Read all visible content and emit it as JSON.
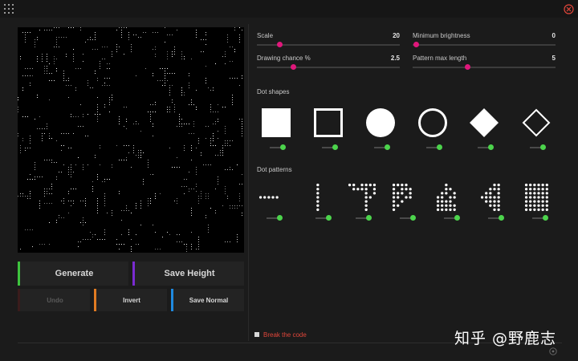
{
  "buttons": {
    "generate": "Generate",
    "save_height": "Save Height",
    "undo": "Undo",
    "invert": "Invert",
    "save_normal": "Save Normal"
  },
  "button_colors": {
    "generate": "#3ec43e",
    "save_height": "#7a2bd1",
    "undo": "#3a1c1c",
    "invert": "#e07b22",
    "save_normal": "#1f8ae0"
  },
  "sliders": [
    {
      "label": "Scale",
      "value": "20",
      "fraction": 0.16
    },
    {
      "label": "Minimum brightness",
      "value": "0",
      "fraction": 0.02
    },
    {
      "label": "Drawing chance %",
      "value": "2.5",
      "fraction": 0.25
    },
    {
      "label": "Pattern max length",
      "value": "5",
      "fraction": 0.38
    }
  ],
  "dot_shapes": {
    "title": "Dot shapes",
    "items": [
      {
        "icon": "filled-square-icon",
        "on": true
      },
      {
        "icon": "outline-square-icon",
        "on": true
      },
      {
        "icon": "filled-circle-icon",
        "on": true
      },
      {
        "icon": "outline-circle-icon",
        "on": true
      },
      {
        "icon": "filled-diamond-icon",
        "on": true
      },
      {
        "icon": "outline-diamond-icon",
        "on": true
      }
    ]
  },
  "dot_patterns": {
    "title": "Dot patterns",
    "items": [
      {
        "icon": "horizontal-line-pattern-icon",
        "on": true
      },
      {
        "icon": "vertical-line-pattern-icon",
        "on": true
      },
      {
        "icon": "t-pattern-icon",
        "on": true
      },
      {
        "icon": "f-pattern-icon",
        "on": true
      },
      {
        "icon": "staircase-pattern-icon",
        "on": true
      },
      {
        "icon": "diagonal-pattern-icon",
        "on": true
      },
      {
        "icon": "full-grid-pattern-icon",
        "on": true
      }
    ]
  },
  "break_the_code": {
    "label": "Break the code",
    "checked": false
  },
  "watermark": "知乎 @野鹿志",
  "colors": {
    "accent": "#e0177b",
    "toggle_on": "#4cd44c",
    "warning_text": "#e0463a",
    "background": "#1b1b1b",
    "canvas": "#000000"
  }
}
